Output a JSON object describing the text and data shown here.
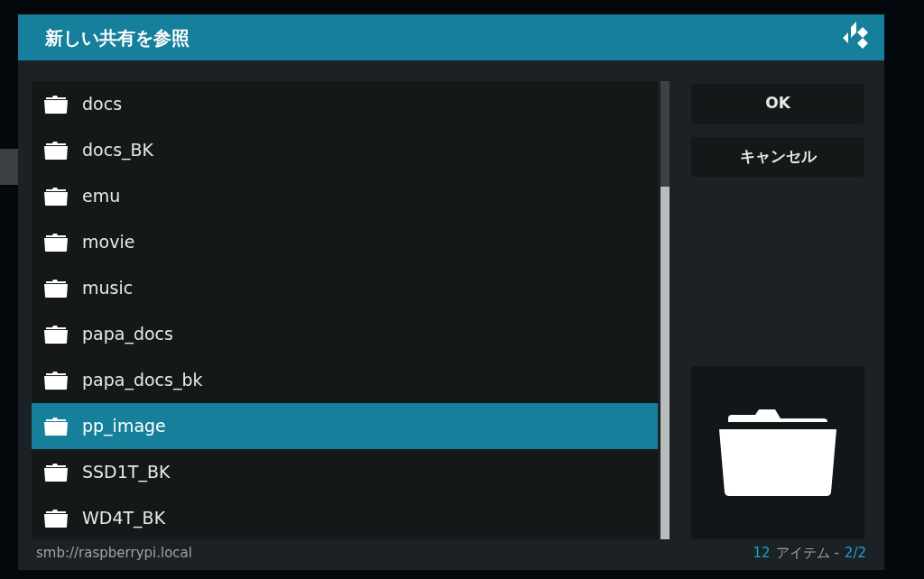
{
  "dialog": {
    "title": "新しい共有を参照"
  },
  "items": [
    {
      "label": "docs",
      "selected": false
    },
    {
      "label": "docs_BK",
      "selected": false
    },
    {
      "label": "emu",
      "selected": false
    },
    {
      "label": "movie",
      "selected": false
    },
    {
      "label": "music",
      "selected": false
    },
    {
      "label": "papa_docs",
      "selected": false
    },
    {
      "label": "papa_docs_bk",
      "selected": false
    },
    {
      "label": "pp_image",
      "selected": true
    },
    {
      "label": "SSD1T_BK",
      "selected": false
    },
    {
      "label": "WD4T_BK",
      "selected": false
    }
  ],
  "buttons": [
    "OK",
    "キャンセル"
  ],
  "status_bar": {
    "path": "smb://raspberrypi.local",
    "count": "12",
    "count_label": "アイテム -",
    "page": "2/2"
  }
}
